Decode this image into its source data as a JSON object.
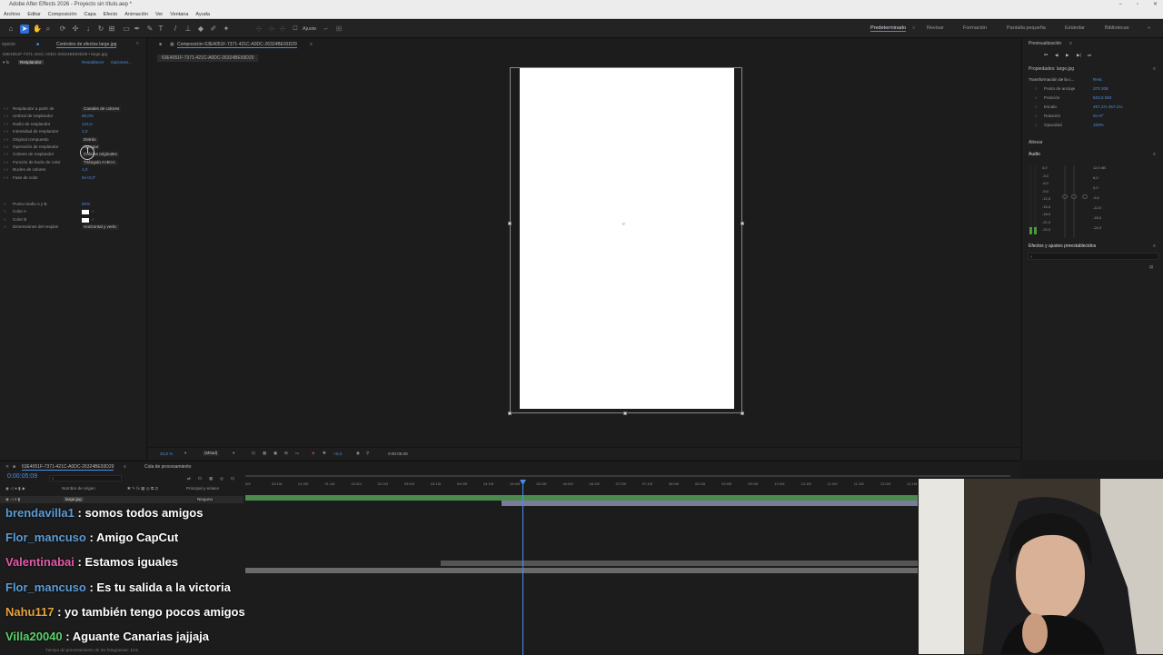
{
  "window": {
    "title": "Adobe After Effects 2026 - Proyecto sin título.aep *"
  },
  "menu": [
    "Archivo",
    "Editar",
    "Composición",
    "Capa",
    "Efecto",
    "Animación",
    "Ver",
    "Ventana",
    "Ayuda"
  ],
  "toolbar": {
    "snap_label": "Ajuste"
  },
  "workspaces": [
    "Predeterminado",
    "Revisar",
    "Formación",
    "Pantalla pequeña",
    "Estándar",
    "Bibliotecas"
  ],
  "project_tabs": {
    "project": "oyecto",
    "effects": "Controles de efectos large.jpg"
  },
  "effects_panel": {
    "layer_path": "63E4051F-7371-421C-A0DC-26324BE93D29 • large.jpg",
    "effect_name": "Resplandor",
    "reset": "Restablecer",
    "options": "Opciones...",
    "rows": [
      {
        "label": "Resplandor a partir de",
        "value": "Canales de colores",
        "kind": "drop"
      },
      {
        "label": "Umbral de resplandor",
        "value": "60,0%",
        "kind": "val"
      },
      {
        "label": "Radio de resplandor",
        "value": "124,0",
        "kind": "val"
      },
      {
        "label": "Intensidad de resplandor",
        "value": "1,0",
        "kind": "val"
      },
      {
        "label": "Original compuesto",
        "value": "Detrás",
        "kind": "drop"
      },
      {
        "label": "Operación de resplandor",
        "value": "Agregar",
        "kind": "drop"
      },
      {
        "label": "Colores de resplandor",
        "value": "Colores originales",
        "kind": "drop"
      },
      {
        "label": "Función de bucle de color",
        "value": "Triángulo A>B>A",
        "kind": "drop"
      },
      {
        "label": "Bucles de colores",
        "value": "1,0",
        "kind": "val"
      },
      {
        "label": "Fase de color",
        "value": "0x+0,0°",
        "kind": "val"
      }
    ],
    "rows2": [
      {
        "label": "Punto medio A y B",
        "value": "50%",
        "kind": "val"
      },
      {
        "label": "Color A",
        "value": "",
        "kind": "swatch"
      },
      {
        "label": "Color B",
        "value": "",
        "kind": "swatch"
      },
      {
        "label": "Dimensiones del resplan",
        "value": "Horizontal y vertic",
        "kind": "drop"
      }
    ]
  },
  "composition": {
    "tab_label": "Composición 63E4051F-7371-421C-A0DC-26324BE93D29",
    "sub_tab": "63E4051F-7371-421C-A0DC-26324BE93D29",
    "zoom": "43,8 %",
    "resolution": "(Mitad)",
    "exposure": "+0,0",
    "timecode": "0:00:05:09"
  },
  "right_panel": {
    "preview_title": "Previsualización",
    "properties_title": "Propiedades: large.jpg",
    "transform_label": "Transformación de la c...",
    "transform_reset": "Rest.",
    "props": [
      {
        "label": "Punto de anclaje",
        "value": "370   208"
      },
      {
        "label": "Posición",
        "value": "533,5   992"
      },
      {
        "label": "Escala",
        "value": "457,1%   457,1%"
      },
      {
        "label": "Rotación",
        "value": "0x+0°"
      },
      {
        "label": "Opacidad",
        "value": "100%"
      }
    ],
    "align_title": "Alinear",
    "audio_title": "Audio",
    "audio_left": [
      "0,0",
      "-3,0",
      "-6,0",
      "-9,0",
      "-12,0",
      "-15,0",
      "-18,0",
      "-21,0",
      "-24,0"
    ],
    "audio_right": [
      "12,0 dB",
      "6,0",
      "0,0",
      "-6,0",
      "-12,0",
      "-18,0",
      "-24,0"
    ],
    "effects_presets_title": "Efectos y ajustes preestablecidos"
  },
  "timeline": {
    "tab_label": "63E4051F-7371-421C-A0DC-26324BE93D29",
    "render_queue": "Cola de procesamiento",
    "current_time": "0:00:05:09",
    "col_name": "Nombre de origen",
    "col_parent": "Principal y enlace",
    "layer_name": "large.jpg",
    "parent_value": "Ninguno",
    "ticks": [
      "00f",
      "00:15f",
      "01:00f",
      "01:15f",
      "02:00f",
      "02:15f",
      "03:00f",
      "03:15f",
      "04:00f",
      "04:15f",
      "05:00f",
      "05:15f",
      "06:00f",
      "06:15f",
      "07:00f",
      "07:15f",
      "08:00f",
      "08:15f",
      "09:00f",
      "09:15f",
      "10:00f",
      "10:15f",
      "11:00f",
      "11:15f",
      "12:00f",
      "12:15f"
    ],
    "footer": "Tiempo de procesamiento de los fotogramas: 1ms"
  },
  "chat": [
    {
      "user": "brendavilla1",
      "message": "somos todos amigos",
      "color": "#5b9bd5"
    },
    {
      "user": "Flor_mancuso",
      "message": "Amigo CapCut",
      "color": "#5b9bd5"
    },
    {
      "user": "Valentinabai",
      "message": "Estamos iguales",
      "color": "#e05aa8"
    },
    {
      "user": "Flor_mancuso",
      "message": "Es tu salida a la victoria",
      "color": "#5b9bd5"
    },
    {
      "user": "Nahu117",
      "message": "yo también tengo pocos amigos",
      "color": "#e8a23c"
    },
    {
      "user": "Villa20040",
      "message": "Aguante Canarias jajjaja",
      "color": "#5ad26a"
    }
  ]
}
